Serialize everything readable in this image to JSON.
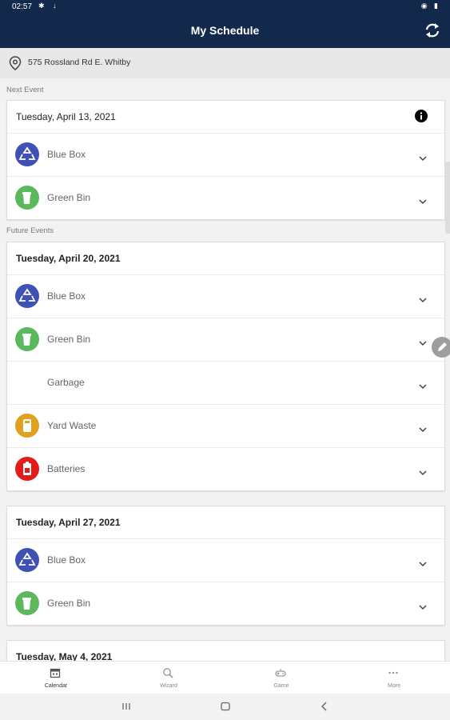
{
  "status_bar": {
    "time": "02:57"
  },
  "header": {
    "title": "My Schedule"
  },
  "address": {
    "text": "575 Rossland Rd E. Whitby"
  },
  "next_event": {
    "label": "Next Event",
    "date": "Tuesday, April 13, 2021",
    "items": [
      {
        "label": "Blue Box",
        "color": "#3f51b5",
        "icon": "recycle-icon"
      },
      {
        "label": "Green Bin",
        "color": "#5cb85c",
        "icon": "bin-icon"
      }
    ]
  },
  "future_events": {
    "label": "Future Events",
    "events": [
      {
        "date": "Tuesday, April 20, 2021",
        "items": [
          {
            "label": "Blue Box",
            "color": "#3f51b5",
            "icon": "recycle-icon"
          },
          {
            "label": "Green Bin",
            "color": "#5cb85c",
            "icon": "bin-icon"
          },
          {
            "label": "Garbage",
            "color": "",
            "icon": ""
          },
          {
            "label": "Yard Waste",
            "color": "#e0a020",
            "icon": "yard-bag-icon"
          },
          {
            "label": "Batteries",
            "color": "#e31b1b",
            "icon": "battery-icon"
          }
        ]
      },
      {
        "date": "Tuesday, April 27, 2021",
        "items": [
          {
            "label": "Blue Box",
            "color": "#3f51b5",
            "icon": "recycle-icon"
          },
          {
            "label": "Green Bin",
            "color": "#5cb85c",
            "icon": "bin-icon"
          }
        ]
      },
      {
        "date": "Tuesday, May 4, 2021",
        "items": []
      }
    ]
  },
  "bottom_nav": [
    {
      "label": "Calendar",
      "icon": "calendar-icon",
      "active": true
    },
    {
      "label": "Wizard",
      "icon": "search-icon",
      "active": false
    },
    {
      "label": "Game",
      "icon": "gamepad-icon",
      "active": false
    },
    {
      "label": "More",
      "icon": "more-icon",
      "active": false
    }
  ]
}
